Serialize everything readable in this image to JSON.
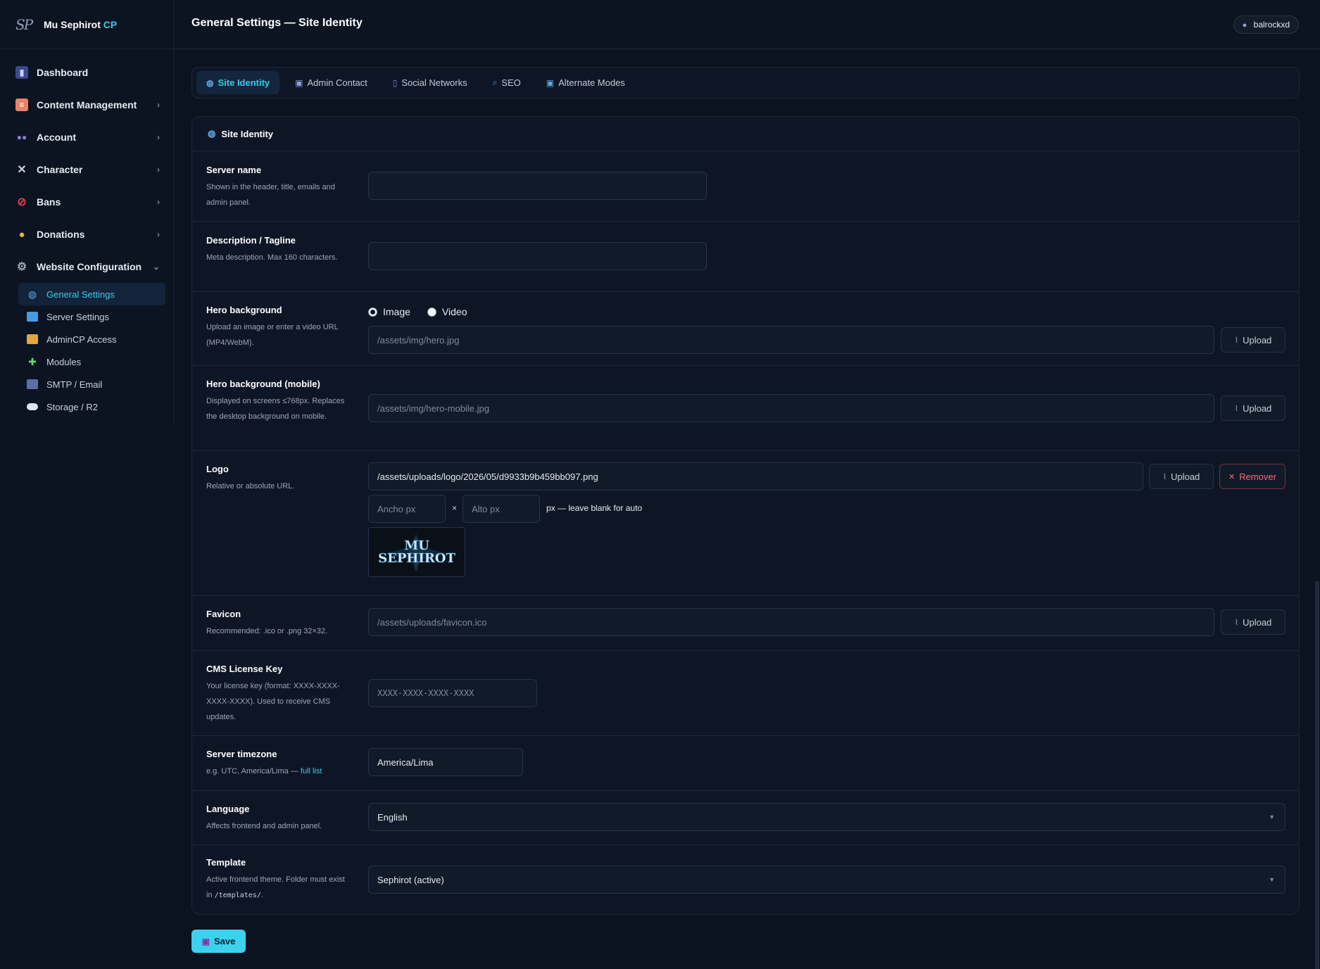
{
  "brand": {
    "name": "Mu Sephirot",
    "suffix": "CP",
    "logo_text": "SP"
  },
  "sidebar": {
    "items": [
      {
        "label": "Dashboard",
        "icon": "chart-icon",
        "color": "#7a86d6"
      },
      {
        "label": "Content Management",
        "icon": "document-icon",
        "color": "#e8826a"
      },
      {
        "label": "Account",
        "icon": "users-icon",
        "color": "#8a7ad6"
      },
      {
        "label": "Character",
        "icon": "swords-icon",
        "color": "#c9d2de"
      },
      {
        "label": "Bans",
        "icon": "prohibited-icon",
        "color": "#e0404f"
      },
      {
        "label": "Donations",
        "icon": "money-bag-icon",
        "color": "#e8b04a"
      },
      {
        "label": "Website Configuration",
        "icon": "gear-icon",
        "color": "#9aa6b6"
      }
    ],
    "sub_items": [
      {
        "label": "General Settings",
        "icon": "globe-icon",
        "active": true
      },
      {
        "label": "Server Settings",
        "icon": "monitor-icon"
      },
      {
        "label": "AdminCP Access",
        "icon": "lock-icon"
      },
      {
        "label": "Modules",
        "icon": "puzzle-icon"
      },
      {
        "label": "SMTP / Email",
        "icon": "envelope-icon"
      },
      {
        "label": "Storage / R2",
        "icon": "cloud-icon"
      }
    ]
  },
  "header": {
    "title": "General Settings — Site Identity",
    "user": "balrockxd"
  },
  "tabs": [
    {
      "label": "Site Identity",
      "icon": "globe-icon",
      "active": true
    },
    {
      "label": "Admin Contact",
      "icon": "id-card-icon"
    },
    {
      "label": "Social Networks",
      "icon": "phone-icon"
    },
    {
      "label": "SEO",
      "icon": "search-icon"
    },
    {
      "label": "Alternate Modes",
      "icon": "mode-icon"
    }
  ],
  "section": {
    "title": "Site Identity",
    "fields": {
      "server_name": {
        "label": "Server name",
        "desc": "Shown in the header, title, emails and admin panel.",
        "value": ""
      },
      "description": {
        "label": "Description / Tagline",
        "desc": "Meta description. Max 160 characters.",
        "value": ""
      },
      "hero_bg": {
        "label": "Hero background",
        "desc": "Upload an image or enter a video URL (MP4/WebM).",
        "value": "/assets/img/hero.jpg",
        "option_image": "Image",
        "option_video": "Video",
        "selected": "Image"
      },
      "hero_bg_mobile": {
        "label": "Hero background (mobile)",
        "desc": "Displayed on screens ≤768px. Replaces the desktop background on mobile.",
        "value": "/assets/img/hero-mobile.jpg"
      },
      "logo": {
        "label": "Logo",
        "desc": "Relative or absolute URL.",
        "value": "/assets/uploads/logo/2026/05/d9933b9b459bb097.png",
        "width_placeholder": "Ancho px",
        "height_placeholder": "Alto px",
        "times": "×",
        "dims_note": "px — leave blank for auto",
        "preview_text_1": "MU",
        "preview_text_2": "SEPHIROT"
      },
      "favicon": {
        "label": "Favicon",
        "desc": "Recommended: .ico or .png 32×32.",
        "value": "/assets/uploads/favicon.ico"
      },
      "license": {
        "label": "CMS License Key",
        "desc": "Your license key (format: XXXX-XXXX-XXXX-XXXX). Used to receive CMS updates.",
        "placeholder": "XXXX-XXXX-XXXX-XXXX"
      },
      "timezone": {
        "label": "Server timezone",
        "desc_prefix": "e.g. UTC, America/Lima — ",
        "desc_link": "full list",
        "value": "America/Lima"
      },
      "language": {
        "label": "Language",
        "desc": "Affects frontend and admin panel.",
        "value": "English"
      },
      "template": {
        "label": "Template",
        "desc_prefix": "Active frontend theme. Folder must exist in ",
        "desc_code": "/templates/",
        "desc_suffix": ".",
        "value": "Sephirot (active)"
      }
    },
    "upload_label": "Upload",
    "remove_label": "Remover"
  },
  "save_label": "Save",
  "colors": {
    "accent": "#3cc9ea",
    "background": "#0b1220",
    "panel": "#0e1626",
    "danger": "#f26d7a"
  }
}
